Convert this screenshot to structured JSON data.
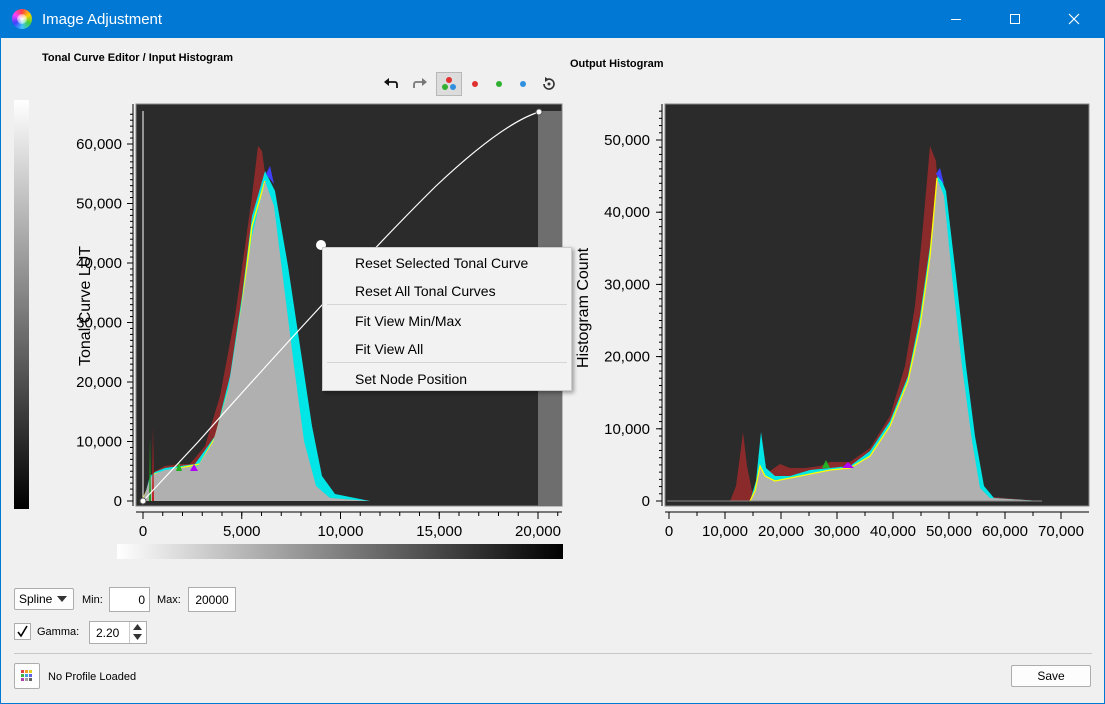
{
  "window": {
    "title": "Image Adjustment"
  },
  "left_panel": {
    "header": "Tonal Curve Editor / Input Histogram",
    "y_axis_label": "Tonal Curve LUT",
    "y_ticks": [
      "60,000",
      "50,000",
      "40,000",
      "30,000",
      "20,000",
      "10,000",
      "0"
    ],
    "x_ticks": [
      "0",
      "5,000",
      "10,000",
      "15,000",
      "20,000"
    ]
  },
  "right_panel": {
    "header": "Output Histogram",
    "y_axis_label": "Histogram Count",
    "y_ticks": [
      "50,000",
      "40,000",
      "30,000",
      "20,000",
      "10,000",
      "0"
    ],
    "x_ticks": [
      "0",
      "10,000",
      "20,000",
      "30,000",
      "40,000",
      "50,000",
      "60,000",
      "70,000"
    ]
  },
  "toolbar": {
    "icons": [
      "undo-icon",
      "redo-icon",
      "rgb-all-icon",
      "red-channel-icon",
      "green-channel-icon",
      "blue-channel-icon",
      "reset-icon"
    ]
  },
  "context_menu": {
    "items": [
      "Reset Selected Tonal Curve",
      "Reset All Tonal Curves",
      "Fit View Min/Max",
      "Fit View All",
      "Set Node Position"
    ]
  },
  "controls": {
    "curve_type": "Spline",
    "min_label": "Min:",
    "min_value": "0",
    "max_label": "Max:",
    "max_value": "20000",
    "gamma_label": "Gamma:",
    "gamma_value": "2.20",
    "gamma_checked": true
  },
  "footer": {
    "profile_status": "No Profile Loaded",
    "save_label": "Save"
  },
  "colors": {
    "titlebar": "#0078d4",
    "plot_bg": "#2b2b2b",
    "red_channel": "#8b2a2a",
    "cyan_channel": "#00e5e5",
    "gray_fill": "#b0b0b0"
  }
}
